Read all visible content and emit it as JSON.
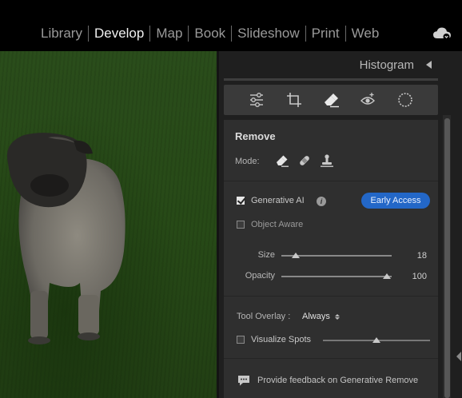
{
  "modules": [
    "Library",
    "Develop",
    "Map",
    "Book",
    "Slideshow",
    "Print",
    "Web"
  ],
  "active_module": "Develop",
  "icons": {
    "cloud": "cloud-sync-icon",
    "tools": [
      "edit-sliders-icon",
      "crop-icon",
      "remove-eraser-icon",
      "red-eye-icon",
      "masking-icon"
    ],
    "modes": [
      "remove-eraser-icon",
      "heal-bandage-icon",
      "clone-stamp-icon"
    ],
    "info": "info-icon",
    "feedback": "feedback-bubble-icon"
  },
  "panel": {
    "histogram_title": "Histogram",
    "section_title": "Remove",
    "mode_label": "Mode:",
    "generative_ai_label": "Generative AI",
    "generative_ai_checked": true,
    "info_glyph": "i",
    "early_access_label": "Early Access",
    "object_aware_label": "Object Aware",
    "object_aware_checked": false,
    "size_label": "Size",
    "size_value": "18",
    "size_level": 0.18,
    "opacity_label": "Opacity",
    "opacity_value": "100",
    "opacity_level": 1.0,
    "tool_overlay_label": "Tool Overlay :",
    "tool_overlay_value": "Always",
    "visualize_spots_label": "Visualize Spots",
    "visualize_spots_checked": false,
    "visualize_spots_level": 0.5,
    "feedback_label": "Provide feedback on Generative Remove"
  },
  "colors": {
    "accent": "#2367c7",
    "panel_bg": "#2f2f2f",
    "grass": "#2a4d1b"
  }
}
